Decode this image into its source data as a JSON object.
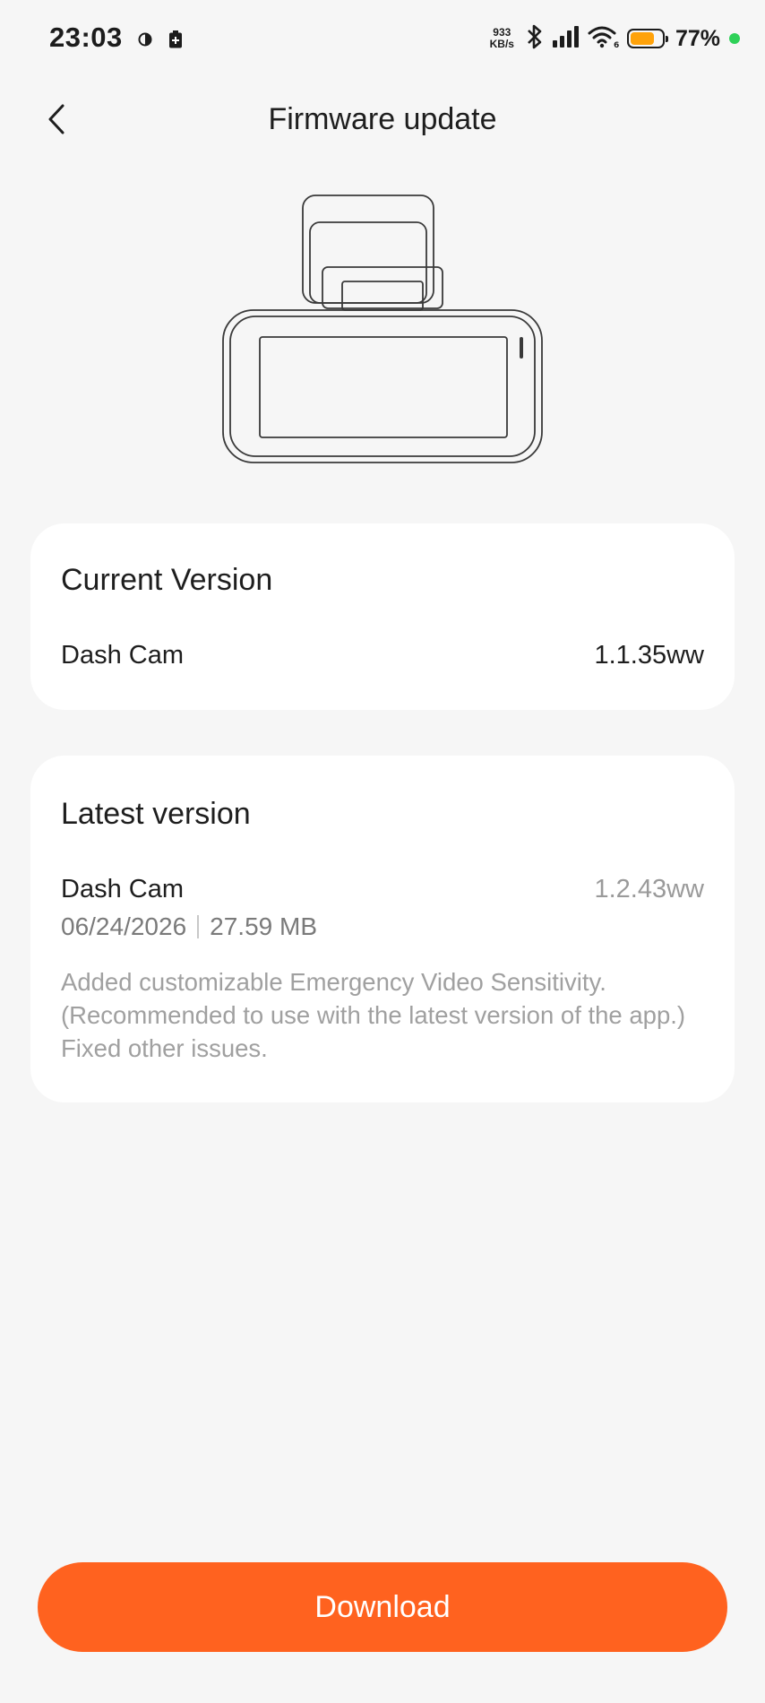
{
  "status_bar": {
    "time": "23:03",
    "net_speed_value": "933",
    "net_speed_unit": "KB/s",
    "battery_percent": "77%",
    "battery_level": 0.77,
    "icons": [
      "moon-icon",
      "battery-saver-icon",
      "bluetooth-icon",
      "signal-icon",
      "wifi-icon",
      "battery-icon",
      "active-dot-icon"
    ],
    "colors": {
      "battery_fill": "#ffa20a",
      "active_dot": "#2ed158"
    }
  },
  "header": {
    "title": "Firmware update",
    "back_icon": "chevron-left-icon"
  },
  "illustration": {
    "icon": "dash-cam-icon"
  },
  "current_version": {
    "title": "Current Version",
    "device_name": "Dash Cam",
    "version": "1.1.35ww"
  },
  "latest_version": {
    "title": "Latest version",
    "device_name": "Dash Cam",
    "version": "1.2.43ww",
    "date": "06/24/2026",
    "size": "27.59 MB",
    "notes": [
      "Added customizable Emergency Video Sensitivity.",
      "(Recommended to use with the latest version of the app.)",
      "Fixed other issues."
    ]
  },
  "actions": {
    "download_label": "Download",
    "download_color": "#ff621f"
  }
}
